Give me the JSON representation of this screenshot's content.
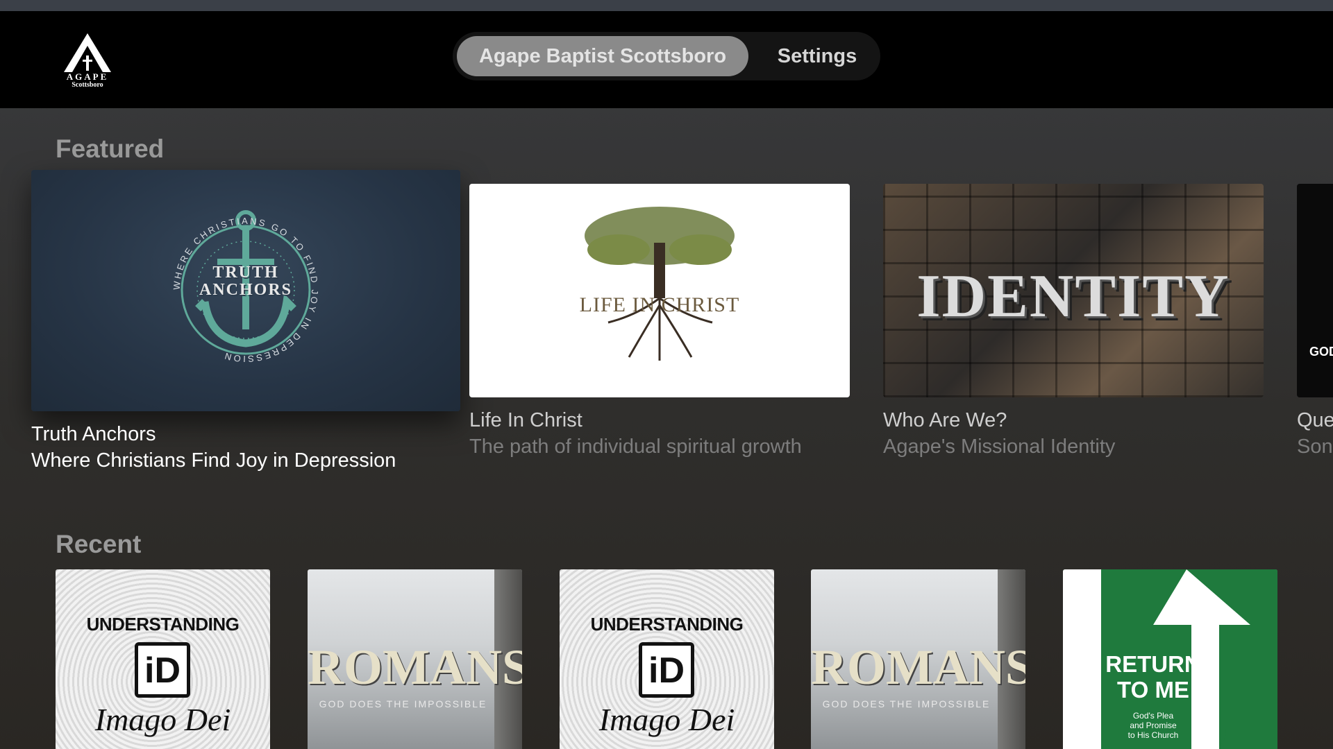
{
  "header": {
    "logo": {
      "word": "AGAPE",
      "sub": "Scottsboro"
    },
    "tabs": [
      {
        "label": "Agape Baptist Scottsboro",
        "active": true
      },
      {
        "label": "Settings",
        "active": false
      }
    ]
  },
  "featured": {
    "title": "Featured",
    "items": [
      {
        "title": "Truth Anchors",
        "subtitle": "Where Christians Find Joy in Depression",
        "art": {
          "top": "TRUTH",
          "bottom": "ANCHORS",
          "ring": "WHERE CHRISTIANS GO TO FIND JOY IN DEPRESSION"
        }
      },
      {
        "title": "Life In Christ",
        "subtitle": "The path of individual spiritual growth",
        "art": {
          "text": "LIFE IN CHRIST"
        }
      },
      {
        "title": "Who Are We?",
        "subtitle": "Agape's Missional Identity",
        "art": {
          "text": "IDENTITY"
        }
      },
      {
        "title": "Que",
        "subtitle": "Son",
        "art": {
          "text": "GOD"
        }
      }
    ]
  },
  "recent": {
    "title": "Recent",
    "items": [
      {
        "art_type": "understanding",
        "line1": "UNDERSTANDING",
        "mark": "iD",
        "line2": "Imago Dei"
      },
      {
        "art_type": "romans",
        "line1": "ROMANS",
        "line2": "GOD DOES THE IMPOSSIBLE"
      },
      {
        "art_type": "understanding",
        "line1": "UNDERSTANDING",
        "mark": "iD",
        "line2": "Imago Dei"
      },
      {
        "art_type": "romans",
        "line1": "ROMANS",
        "line2": "GOD DOES THE IMPOSSIBLE"
      },
      {
        "art_type": "return",
        "line1": "RETURN",
        "line2": "TO ME",
        "line3": "God's Plea",
        "line4": "and Promise",
        "line5": "to His Church"
      }
    ]
  },
  "colors": {
    "truth_teal": "#5fa99a",
    "life_olive": "#6b7a3e",
    "return_green": "#1f7a3d"
  }
}
